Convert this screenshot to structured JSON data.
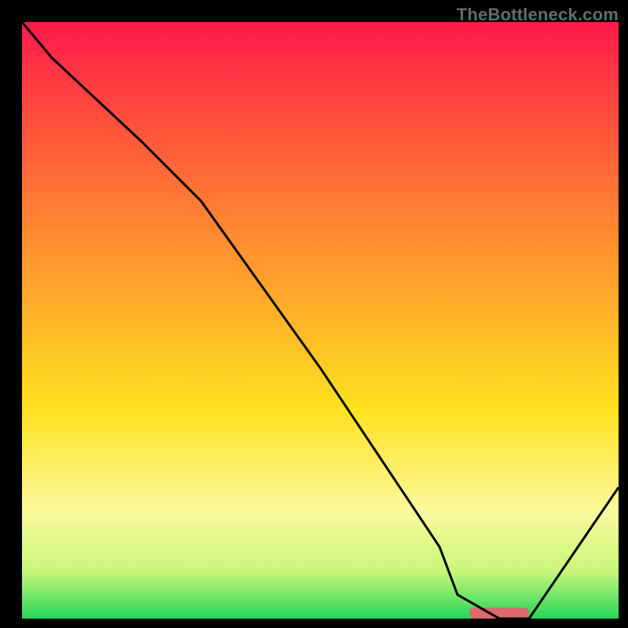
{
  "watermark": "TheBottleneck.com",
  "chart_data": {
    "type": "line",
    "title": "",
    "xlabel": "",
    "ylabel": "",
    "xlim": [
      0,
      100
    ],
    "ylim": [
      0,
      100
    ],
    "legend": false,
    "grid": false,
    "background_gradient": {
      "direction": "vertical",
      "stops": [
        {
          "offset": 0.0,
          "color": "#ff1a4b"
        },
        {
          "offset": 0.2,
          "color": "#ff5a3a"
        },
        {
          "offset": 0.45,
          "color": "#ffa62a"
        },
        {
          "offset": 0.65,
          "color": "#ffe11f"
        },
        {
          "offset": 0.82,
          "color": "#fbf99c"
        },
        {
          "offset": 0.92,
          "color": "#c9f77a"
        },
        {
          "offset": 1.0,
          "color": "#26d65a"
        }
      ]
    },
    "series": [
      {
        "name": "curve",
        "color": "#000000",
        "x": [
          0,
          5,
          20,
          30,
          50,
          70,
          73,
          80,
          85,
          100
        ],
        "y": [
          100,
          94,
          80,
          70,
          42,
          12,
          4,
          0,
          0,
          22
        ]
      }
    ],
    "annotations": [
      {
        "name": "marker-bar",
        "shape": "rounded-rect",
        "color": "#d86b6f",
        "x_range": [
          75,
          85
        ],
        "y": 0
      }
    ]
  }
}
